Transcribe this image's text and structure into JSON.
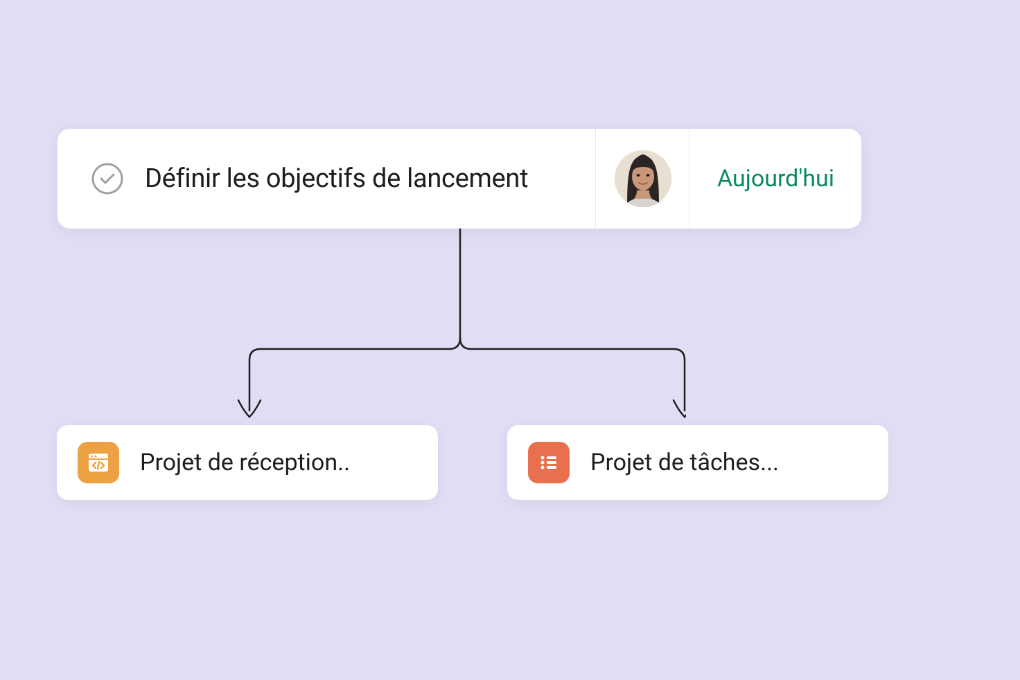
{
  "task": {
    "title": "Définir les objectifs de lancement",
    "due_label": "Aujourd'hui",
    "due_color": "#0a8a5f"
  },
  "projects": [
    {
      "label": "Projet de réception..",
      "icon": "code-window-icon",
      "icon_color": "#eea142"
    },
    {
      "label": "Projet de tâches...",
      "icon": "list-icon",
      "icon_color": "#e8704f"
    }
  ]
}
